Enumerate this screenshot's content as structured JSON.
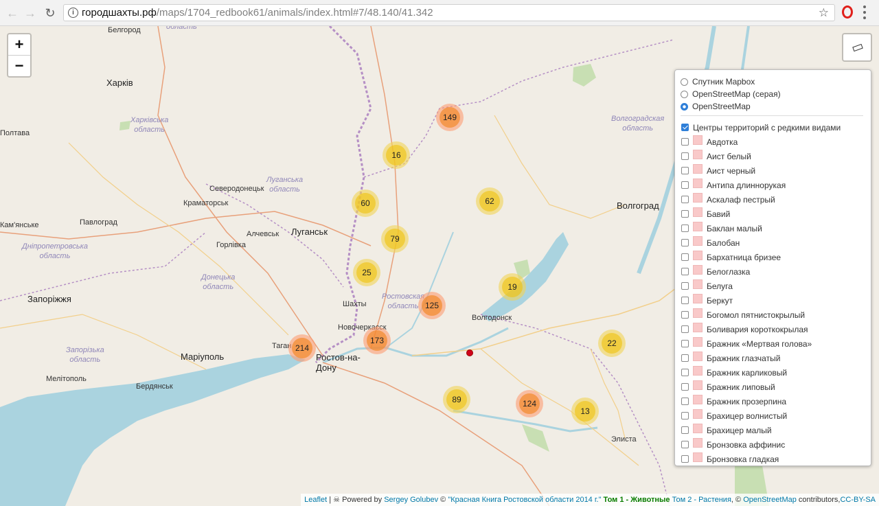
{
  "browser": {
    "url_host": "городшахты.рф",
    "url_path": "/maps/1704_redbook61/animals/index.html#7/48.140/41.342"
  },
  "map": {
    "zoom_in": "+",
    "zoom_out": "−",
    "labels": {
      "belgorod": "Белгород",
      "belgorod_obl": "область",
      "kharkiv": "Харків",
      "kharkiv_obl": "Харківська\nобласть",
      "poltava": "Полтава",
      "severodonetsk": "Северодонецьк",
      "kramatorsk": "Краматорськ",
      "luhansk_obl": "Луганська\nобласть",
      "kamianske": "Кам'янське",
      "pavlohrad": "Павлоград",
      "alchevsk": "Алчевськ",
      "luhansk": "Луганськ",
      "horlivka": "Горлівка",
      "dnipro_obl": "Дніпропетровська\nобласть",
      "donetsk_obl": "Донецька\nобласть",
      "zaporizhzhia": "Запоріжжя",
      "shakhty": "Шахты",
      "rostov_obl": "Ростовская\nобласть",
      "novocherkassk": "Новочеркасск",
      "volgodonsk": "Волгодонск",
      "zaporizhzhia_obl": "Запорізька\nобласть",
      "mariupol": "Маріуполь",
      "taganrog": "Таган",
      "rostov": "Ростов-на-\nДону",
      "melitopol": "Мелітополь",
      "berdiansk": "Бердянськ",
      "volgograd_obl": "Волгоградская\nобласть",
      "volgograd": "Волгоград",
      "elista": "Элиста"
    },
    "clusters": [
      {
        "id": "c149",
        "count": "149",
        "color": "orange"
      },
      {
        "id": "c16",
        "count": "16",
        "color": "yellow"
      },
      {
        "id": "c60",
        "count": "60",
        "color": "yellow"
      },
      {
        "id": "c62",
        "count": "62",
        "color": "yellow"
      },
      {
        "id": "c79",
        "count": "79",
        "color": "yellow"
      },
      {
        "id": "c25",
        "count": "25",
        "color": "yellow"
      },
      {
        "id": "c125",
        "count": "125",
        "color": "orange"
      },
      {
        "id": "c19",
        "count": "19",
        "color": "yellow"
      },
      {
        "id": "c173",
        "count": "173",
        "color": "orange"
      },
      {
        "id": "c214",
        "count": "214",
        "color": "orange"
      },
      {
        "id": "c22",
        "count": "22",
        "color": "yellow"
      },
      {
        "id": "c89",
        "count": "89",
        "color": "yellow"
      },
      {
        "id": "c124",
        "count": "124",
        "color": "orange"
      },
      {
        "id": "c13",
        "count": "13",
        "color": "yellow"
      }
    ]
  },
  "layers": {
    "base": [
      {
        "label": "Спутник Mapbox",
        "selected": false
      },
      {
        "label": "OpenStreetMap (серая)",
        "selected": false
      },
      {
        "label": "OpenStreetMap",
        "selected": true
      }
    ],
    "centers": {
      "label": "Центры территорий с редкими видами",
      "checked": true
    },
    "species": [
      "Авдотка",
      "Аист белый",
      "Аист черный",
      "Антипа длиннорукая",
      "Аскалаф пестрый",
      "Бавий",
      "Баклан малый",
      "Балобан",
      "Бархатница бризее",
      "Белоглазка",
      "Белуга",
      "Беркут",
      "Богомол пятнистокрылый",
      "Боливария короткокрылая",
      "Бражник «Мертвая голова»",
      "Бражник глазчатый",
      "Бражник карликовый",
      "Бражник липовый",
      "Бражник прозерпина",
      "Брахицер волнистый",
      "Брахицер малый",
      "Бронзовка аффинис",
      "Бронзовка гладкая"
    ]
  },
  "attribution": {
    "leaflet": "Leaflet",
    "sep": " | ",
    "powered": "☠ Powered by ",
    "author": "Sergey Golubev",
    "copy": " © ",
    "book": "\"Красная Книга Ростовской области 2014 г.\"",
    "vol1": " Том 1 - Животные",
    "vol2": " Том 2 - Растения",
    "osm_pre": ", © ",
    "osm": "OpenStreetMap",
    "contrib": " contributors,",
    "license": "CC-BY-SA"
  }
}
